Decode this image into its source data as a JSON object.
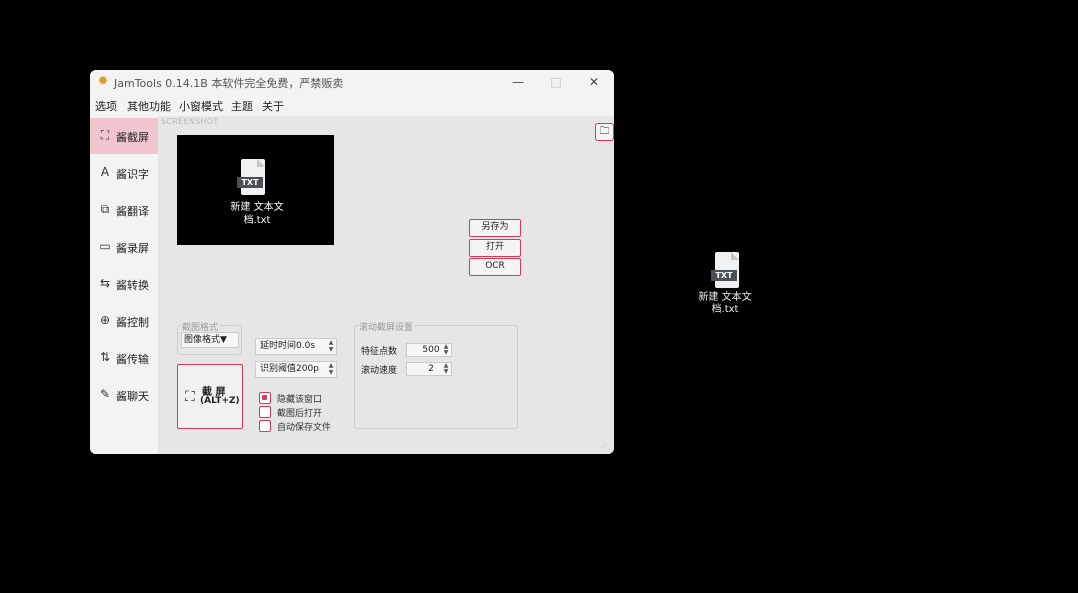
{
  "desktop": {
    "file": {
      "tag": "TXT",
      "name": "新建 文本文档.txt"
    }
  },
  "window": {
    "title": "JamTools 0.14.1B 本软件完全免费，严禁贩卖",
    "buttons": {
      "minimize": "—",
      "maximize": "□",
      "close": "✕"
    }
  },
  "menu": [
    "选项",
    "其他功能",
    "小窗模式",
    "主题",
    "关于"
  ],
  "sidebar": {
    "items": [
      {
        "label": "酱截屏",
        "icon": "crop-icon",
        "glyph": "⛶",
        "active": true
      },
      {
        "label": "酱识字",
        "icon": "text-recognition-icon",
        "glyph": "A",
        "active": false
      },
      {
        "label": "酱翻译",
        "icon": "translate-icon",
        "glyph": "⧉",
        "active": false
      },
      {
        "label": "酱录屏",
        "icon": "record-icon",
        "glyph": "▭",
        "active": false
      },
      {
        "label": "酱转换",
        "icon": "convert-icon",
        "glyph": "⇆",
        "active": false
      },
      {
        "label": "酱控制",
        "icon": "control-icon",
        "glyph": "⊕",
        "active": false
      },
      {
        "label": "酱传输",
        "icon": "transfer-icon",
        "glyph": "⇅",
        "active": false
      },
      {
        "label": "酱聊天",
        "icon": "chat-icon",
        "glyph": "✎",
        "active": false
      }
    ]
  },
  "screenshot": {
    "mode_label": "SCREENSHOT",
    "preview": {
      "tag": "TXT",
      "name": "新建 文本文档.txt"
    },
    "actions": {
      "save_as": "另存为",
      "open": "打开",
      "ocr": "OCR"
    },
    "corner_icon": "folder-icon",
    "format_group": {
      "title": "截图格式",
      "value": "图像格式▼"
    },
    "delay": {
      "value": "延时时间0.0s"
    },
    "threshold": {
      "value": "识别阈值200p"
    },
    "scroll_group": {
      "title": "滚动截屏设置",
      "feature_points_label": "特征点数",
      "feature_points_value": "500",
      "scroll_speed_label": "滚动速度",
      "scroll_speed_value": "2"
    },
    "shot_button": {
      "line1": "截 屏",
      "line2": "(ALT+Z)"
    },
    "checkboxes": [
      {
        "label": "隐藏该窗口",
        "checked": true
      },
      {
        "label": "截图后打开",
        "checked": false
      },
      {
        "label": "自动保存文件",
        "checked": false
      }
    ]
  },
  "colors": {
    "accent": "#d83a5a",
    "active_bg": "#f2c6cf"
  }
}
